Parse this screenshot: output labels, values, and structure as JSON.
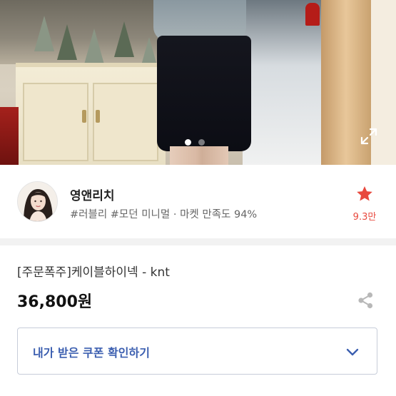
{
  "gallery": {
    "slide_count": 2,
    "active_slide": 1,
    "expand_icon": "expand-icon"
  },
  "shop": {
    "name": "영앤리치",
    "tags": "#러블리 #모던 미니멀 · 마켓 만족도 94%",
    "favorite_icon": "star-icon",
    "favorite_count": "9.3만",
    "accent_color": "#e8493e"
  },
  "product": {
    "title": "[주문폭주]케이블하이넥 - knt",
    "price": "36,800원",
    "share_icon": "share-icon"
  },
  "coupon": {
    "label": "내가 받은 쿠폰 확인하기",
    "icon": "chevron-down-icon",
    "accent_color": "#3c5fb0"
  }
}
